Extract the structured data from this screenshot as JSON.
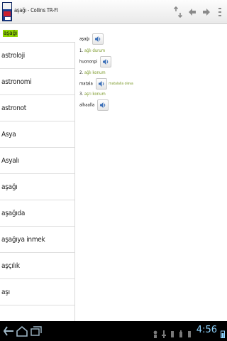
{
  "actionbar": {
    "title": "aşağı - Collins TR-FI",
    "app_icon": "collins-dictionary-icon",
    "buttons": [
      "swap-languages-icon",
      "back-arrow-icon",
      "forward-arrow-icon",
      "overflow-menu-icon"
    ]
  },
  "search": {
    "query": "aşağı"
  },
  "list": {
    "items": [
      "astroloji",
      "astronomi",
      "astronot",
      "Asya",
      "Asyalı",
      "aşağı",
      "aşağıda",
      "aşağıya inmek",
      "aşçılık",
      "aşı"
    ]
  },
  "content": {
    "headword": "aşağı",
    "sense1": {
      "num": "1.",
      "translation": "ağlı durum"
    },
    "entry2": {
      "word": "huononpi"
    },
    "sense2": {
      "num": "2.",
      "translation": "ağlı konum"
    },
    "entry3": {
      "word": "matala",
      "alt": "matalalla oleva"
    },
    "sense3": {
      "num": "3.",
      "translation": "aşrı konum"
    },
    "entry4": {
      "word": "alhaalla"
    }
  },
  "system_bar": {
    "clock": "4:56",
    "nav_icons": [
      "back-nav-icon",
      "home-nav-icon",
      "recent-apps-icon"
    ],
    "accent_color": "#8fd4ff"
  }
}
